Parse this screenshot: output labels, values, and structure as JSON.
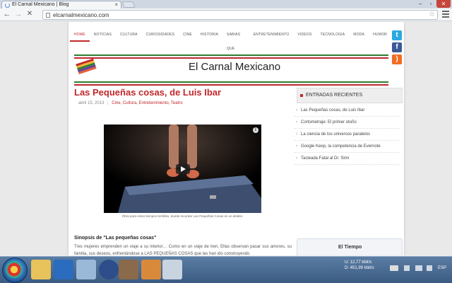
{
  "browser": {
    "tab_title": "El Carnal Mexicano | Blog",
    "tab_close": "×",
    "url": "elcarnalmexicano.com",
    "back": "←",
    "forward": "→",
    "stop": "✕"
  },
  "nav": {
    "items": [
      "HOME",
      "NOTICIAS",
      "CULTURA",
      "CURIOSIDADES",
      "CINE",
      "HISTORIA",
      "SABIAS QUE",
      "ENTRETENIMIENTO",
      "VIDEOS",
      "TECNOLOGIA",
      "MODA",
      "HUMOR"
    ],
    "active": "HOME"
  },
  "social": {
    "twitter_icon": "twitter-icon",
    "facebook_icon": "facebook-icon",
    "rss_icon": "rss-icon",
    "twitter_glyph": "t",
    "facebook_glyph": "f",
    "rss_glyph": ")"
  },
  "site": {
    "title": "El Carnal Mexicano"
  },
  "post": {
    "title": "Las Pequeñas cosas, de Luis Ibar",
    "date": "abril 15, 2013",
    "categories": "Cine, Cultura, Entretenimiento, Teatro",
    "video_caption": "Obra para estos tiempos terribles, donde recordar Las Pequeñas Cosas es un deleite.",
    "synopsis_title": "Sinopsis de \"Las pequeñas cosas\"",
    "synopsis_text": "Tres mujeres emprenden un viaje a su interior… Como en un viaje de tren, Ellas observan pasar sus amores, su familia, sus deseos, enfrentándose a LAS PEQUEÑAS COSAS que las han ido construyendo"
  },
  "sidebar": {
    "recent_title": "ENTRADAS RECIENTES",
    "recent": [
      "Las Pequeñas cosas, de Luis Ibar",
      "Cortometraje: El primer otoño",
      "La ciencia de los universos paralelos",
      "Google Keep, la competencia de Evernote",
      "Tacleada Fatal al Dr. Simi"
    ],
    "weather_title": "El Tiempo"
  },
  "taskbar": {
    "net_up_label": "U:",
    "net_up": "12,77 kbit/s",
    "net_down_label": "D:",
    "net_down": "451,99 kbit/s",
    "lang": "ESP"
  },
  "colors": {
    "accent": "#c0282c"
  }
}
